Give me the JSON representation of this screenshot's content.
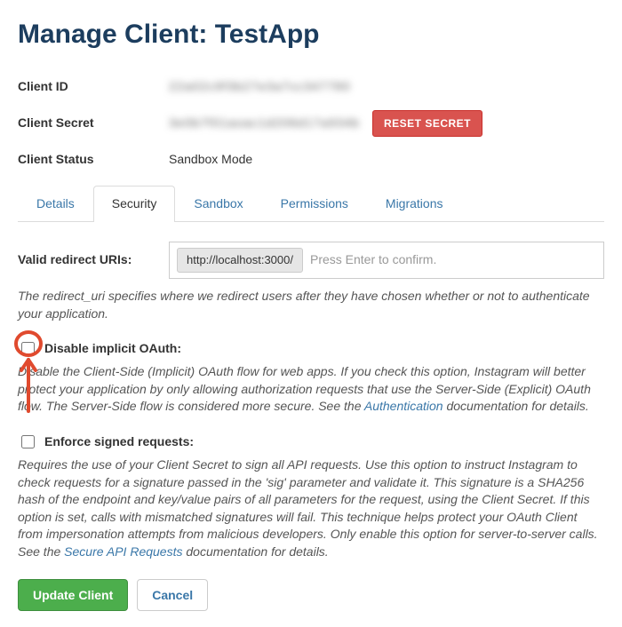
{
  "page_title": "Manage Client: TestApp",
  "info": {
    "client_id_label": "Client ID",
    "client_id_value": "22a02c9f3b27e3a7cc347780",
    "client_secret_label": "Client Secret",
    "client_secret_value": "3e0b7f01aoac1d206d17a934b",
    "reset_secret_label": "RESET SECRET",
    "client_status_label": "Client Status",
    "client_status_value": "Sandbox Mode"
  },
  "tabs": {
    "details": "Details",
    "security": "Security",
    "sandbox": "Sandbox",
    "permissions": "Permissions",
    "migrations": "Migrations"
  },
  "redirect": {
    "label": "Valid redirect URIs:",
    "chip": "http://localhost:3000/",
    "placeholder": "Press Enter to confirm.",
    "helper": "The redirect_uri specifies where we redirect users after they have chosen whether or not to authenticate your application."
  },
  "disable_implicit": {
    "label": "Disable implicit OAuth:",
    "helper_before": "Disable the Client-Side (Implicit) OAuth flow for web apps. If you check this option, Instagram will better protect your application by only allowing authorization requests that use the Server-Side (Explicit) OAuth flow. The Server-Side flow is considered more secure. See the ",
    "helper_link": "Authentication",
    "helper_after": " documentation for details."
  },
  "enforce_signed": {
    "label": "Enforce signed requests:",
    "helper_before": "Requires the use of your Client Secret to sign all API requests. Use this option to instruct Instagram to check requests for a signature passed in the 'sig' parameter and validate it. This signature is a SHA256 hash of the endpoint and key/value pairs of all parameters for the request, using the Client Secret. If this option is set, calls with mismatched signatures will fail. This technique helps protect your OAuth Client from impersonation attempts from malicious developers. Only enable this option for server-to-server calls. See the ",
    "helper_link": "Secure API Requests",
    "helper_after": " documentation for details."
  },
  "actions": {
    "update": "Update Client",
    "cancel": "Cancel"
  }
}
